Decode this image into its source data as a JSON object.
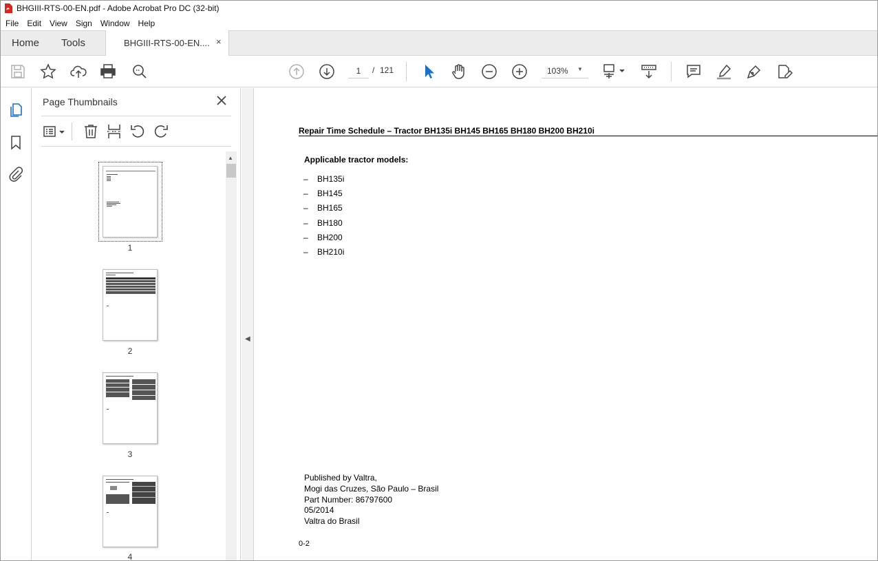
{
  "window": {
    "title": "BHGIII-RTS-00-EN.pdf - Adobe Acrobat Pro DC (32-bit)"
  },
  "menu": [
    "File",
    "Edit",
    "View",
    "Sign",
    "Window",
    "Help"
  ],
  "tabs": {
    "home": "Home",
    "tools": "Tools",
    "document": "BHGIII-RTS-00-EN....",
    "close": "×"
  },
  "toolbar": {
    "current_page": "1",
    "page_separator": "/",
    "total_pages": "121",
    "zoom": "103%"
  },
  "thumbnails_panel": {
    "title": "Page Thumbnails",
    "pages": [
      "1",
      "2",
      "3",
      "4"
    ],
    "selected_page": "1"
  },
  "document": {
    "header": "Repair Time Schedule – Tractor BH135i BH145 BH165 BH180 BH200 BH210i",
    "subheading": "Applicable tractor models:",
    "bullet": "–",
    "models": [
      "BH135i",
      "BH145",
      "BH165",
      "BH180",
      "BH200",
      "BH210i"
    ],
    "publisher_lines": [
      "Published by Valtra,",
      "Mogi das Cruzes, São Paulo – Brasil",
      "Part Number: 86797600",
      "05/2014",
      "Valtra do Brasil"
    ],
    "page_id": "0-2"
  },
  "colors": {
    "accent_blue": "#1a6fc9",
    "pdf_red": "#d9251c"
  },
  "icons": {
    "toolbar": [
      "save-icon",
      "star-icon",
      "upload-icon",
      "print-icon",
      "zoom-search-icon",
      "prev-page-icon",
      "next-page-icon",
      "select-arrow-icon",
      "hand-icon",
      "zoom-out-icon",
      "zoom-in-icon",
      "page-fit-icon",
      "scroll-mode-icon",
      "comment-icon",
      "highlight-icon",
      "sign-icon",
      "fill-sign-icon"
    ],
    "rail": [
      "page-thumbnails-icon",
      "bookmark-icon",
      "attachment-icon"
    ],
    "panel": [
      "options-menu-icon",
      "delete-icon",
      "extract-icon",
      "rotate-ccw-icon",
      "rotate-cw-icon",
      "close-icon"
    ]
  }
}
